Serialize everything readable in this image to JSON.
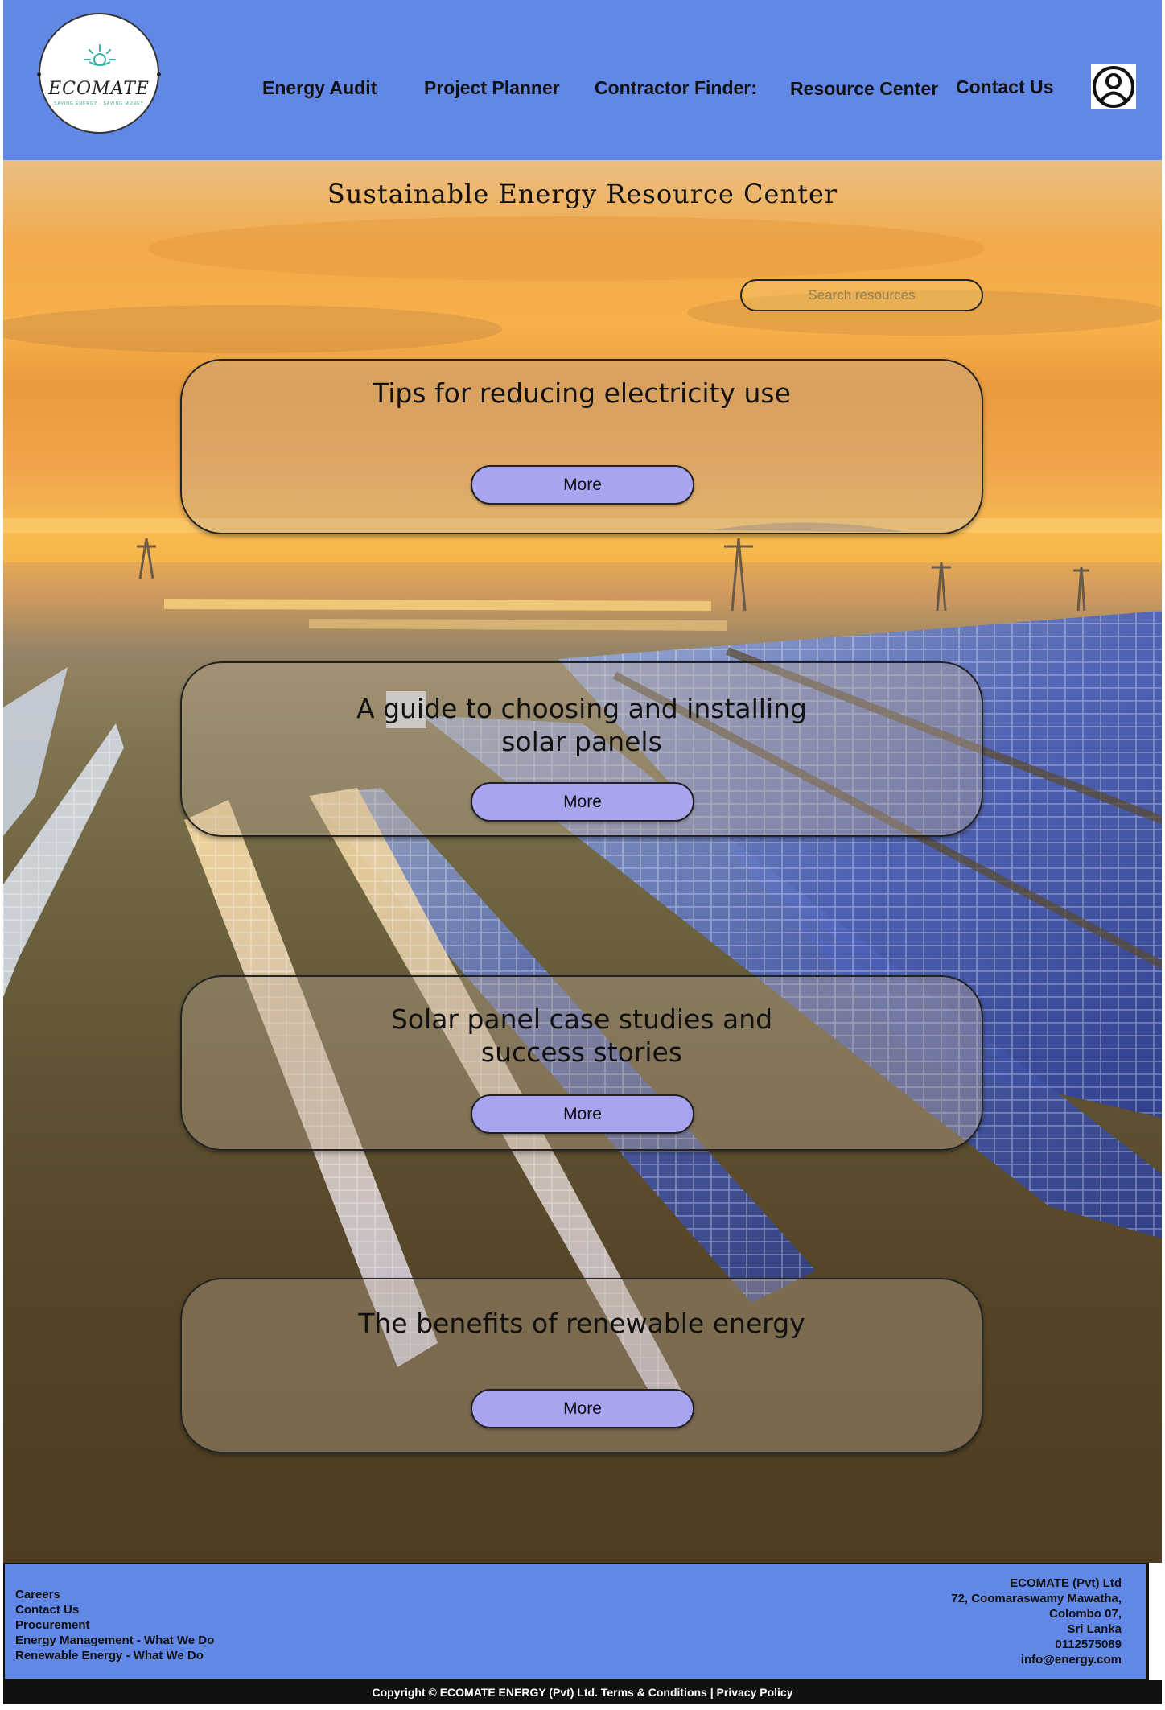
{
  "brand": {
    "name": "ECOMATE",
    "tagline": "SAVING ENERGY · SAVING MONEY",
    "accent": "#6188e6"
  },
  "nav": {
    "items": [
      {
        "label": "Energy Audit"
      },
      {
        "label": "Project Planner"
      },
      {
        "label": "Contractor Finder:"
      },
      {
        "label": "Resource Center"
      },
      {
        "label": "Contact Us"
      }
    ],
    "account_icon": "user-circle-icon"
  },
  "page": {
    "title": "Sustainable Energy Resource Center"
  },
  "search": {
    "placeholder": "Search resources"
  },
  "cards": [
    {
      "title_lines": [
        "Tips for reducing electricity use"
      ],
      "button": "More"
    },
    {
      "title_lines": [
        "A guide to choosing and installing",
        "solar panels"
      ],
      "button": "More"
    },
    {
      "title_lines": [
        "Solar panel case studies and",
        "success stories"
      ],
      "button": "More"
    },
    {
      "title_lines": [
        "The benefits of renewable energy"
      ],
      "button": "More"
    }
  ],
  "footer": {
    "links": [
      "Careers",
      "Contact Us",
      "Procurement",
      "Energy Management - What We Do",
      "Renewable Energy - What We Do"
    ],
    "address": [
      "ECOMATE (Pvt) Ltd",
      "72, Coomaraswamy Mawatha,",
      "Colombo 07,",
      "Sri Lanka",
      "0112575089",
      "info@energy.com"
    ],
    "copyright": "Copyright © ECOMATE ENERGY (Pvt) Ltd.",
    "terms": "Terms & Conditions",
    "separator": "|",
    "privacy": "Privacy Policy"
  }
}
